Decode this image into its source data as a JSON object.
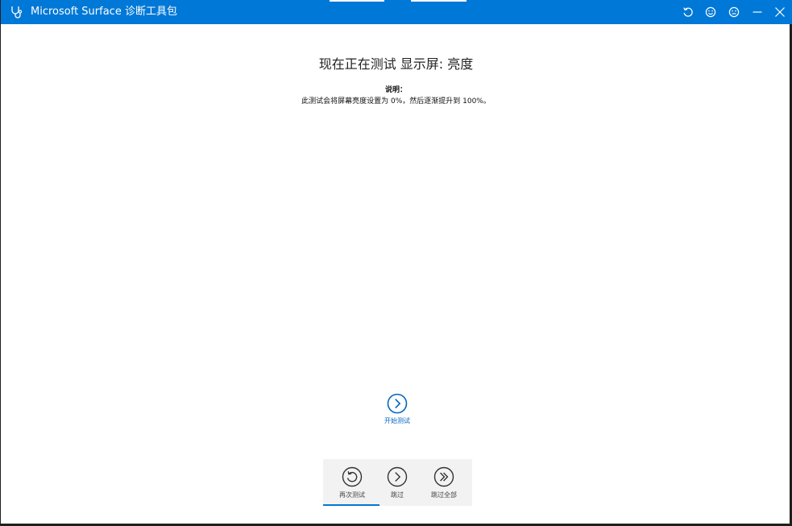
{
  "app": {
    "title": "Microsoft Surface 诊断工具包",
    "accent_color": "#0078d7"
  },
  "titlebar_buttons": [
    {
      "name": "restart-icon"
    },
    {
      "name": "smile-feedback-icon"
    },
    {
      "name": "frown-feedback-icon"
    },
    {
      "name": "minimize-icon"
    },
    {
      "name": "close-icon"
    }
  ],
  "test": {
    "heading": "现在正在测试 显示屏: 亮度",
    "description_title": "说明：",
    "description_text": "此测试会将屏幕亮度设置为 0%，然后逐渐提升到 100%。"
  },
  "start_button": {
    "label": "开始测试",
    "icon": "chevron-right-circle-icon"
  },
  "toolbar": {
    "retry_label": "再次测试",
    "skip_label": "跳过",
    "skip_all_label": "跳过全部"
  }
}
